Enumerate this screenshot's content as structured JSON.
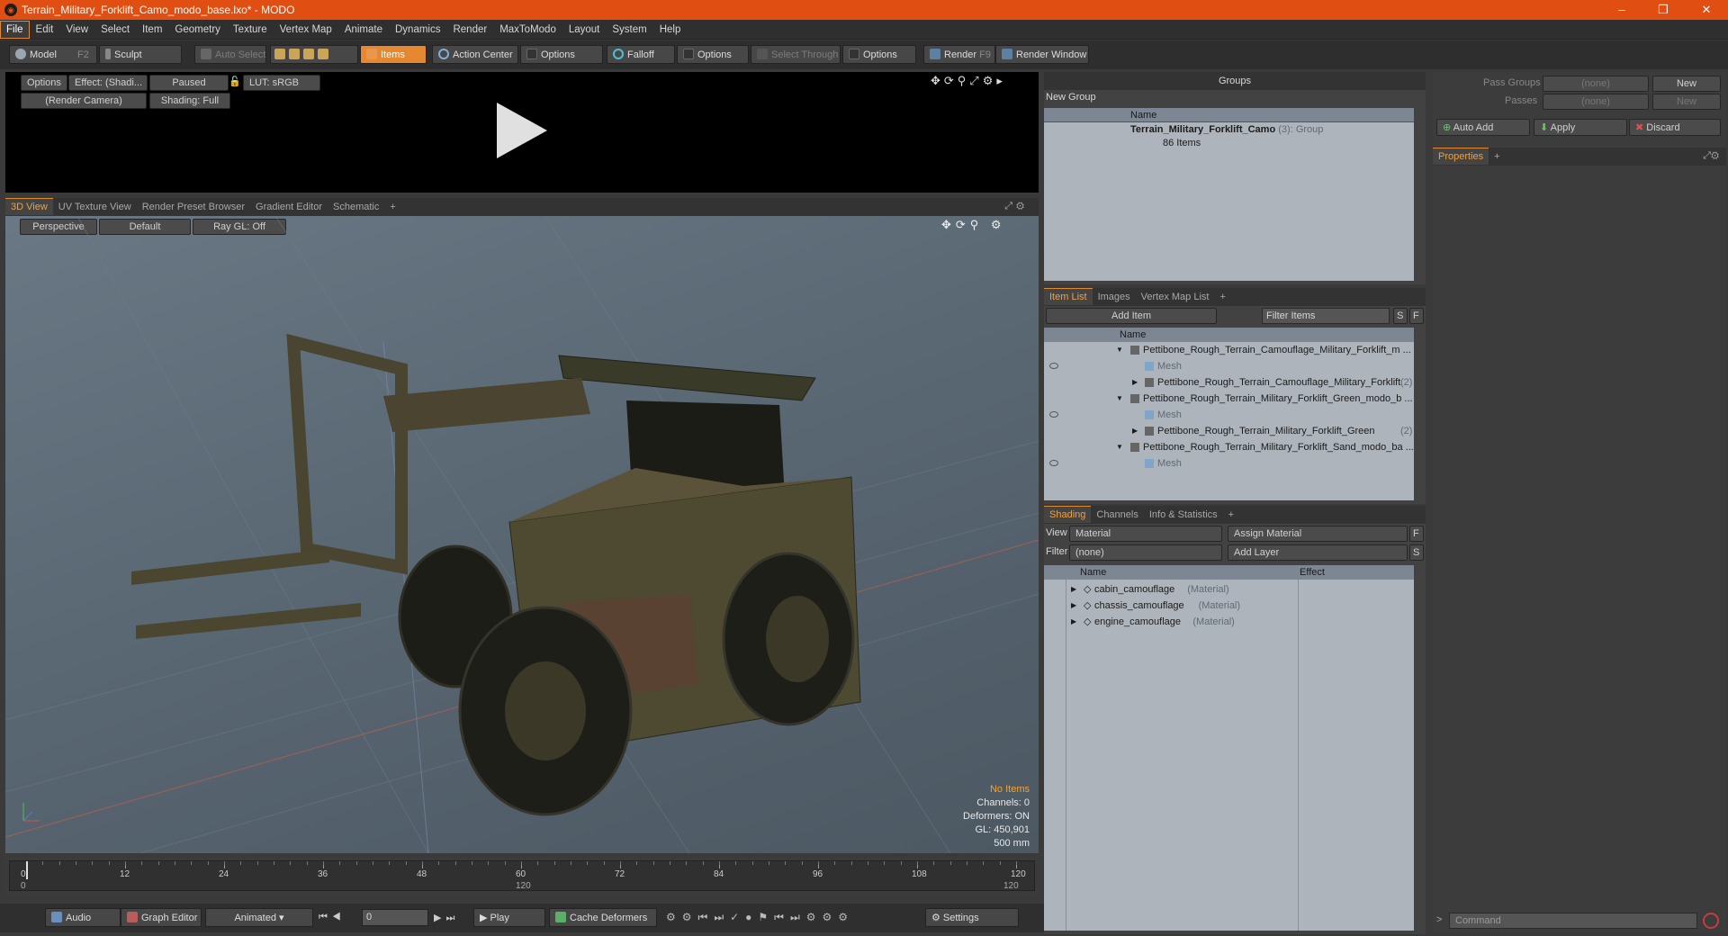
{
  "window": {
    "title": "Terrain_Military_Forklift_Camo_modo_base.lxo* - MODO",
    "app_icon": "modo-logo",
    "minimize": "–",
    "restore": "❐",
    "close": "✕"
  },
  "menu": [
    "File",
    "Edit",
    "View",
    "Select",
    "Item",
    "Geometry",
    "Texture",
    "Vertex Map",
    "Animate",
    "Dynamics",
    "Render",
    "MaxToModo",
    "Layout",
    "System",
    "Help"
  ],
  "toolbar": {
    "model": "Model",
    "model_key": "F2",
    "sculpt": "Sculpt",
    "auto_select": "Auto Select",
    "items": "Items",
    "action_center": "Action Center",
    "options1": "Options",
    "falloff": "Falloff",
    "options2": "Options",
    "select_through": "Select Through",
    "options3": "Options",
    "render": "Render",
    "render_key": "F9",
    "render_window": "Render Window"
  },
  "preview": {
    "options": "Options",
    "effect": "Effect: (Shadi...",
    "paused": "Paused",
    "lut": "LUT: sRGB",
    "camera": "(Render Camera)",
    "shading": "Shading: Full"
  },
  "viewport_tabs": [
    "3D View",
    "UV Texture View",
    "Render Preset Browser",
    "Gradient Editor",
    "Schematic",
    "+"
  ],
  "viewport": {
    "perspective": "Perspective",
    "default": "Default",
    "raygl": "Ray GL: Off",
    "info": {
      "no_items": "No Items",
      "channels": "Channels: 0",
      "deformers": "Deformers: ON",
      "gl": "GL: 450,901",
      "scale": "500 mm"
    }
  },
  "timeline": {
    "ticks_top": [
      "0",
      "12",
      "24",
      "36",
      "48",
      "60",
      "72",
      "84",
      "96",
      "108",
      "120"
    ],
    "ticks_bottom": [
      "0",
      "120",
      "120"
    ]
  },
  "bottom_bar": {
    "audio": "Audio",
    "graph_editor": "Graph Editor",
    "animated": "Animated",
    "frame": "0",
    "play": "Play",
    "cache_deformers": "Cache Deformers",
    "settings": "Settings"
  },
  "groups": {
    "title": "Groups",
    "new_group": "New Group",
    "col_name": "Name",
    "item_name": "Terrain_Military_Forklift_Camo",
    "item_count": "(3)",
    "item_type": ": Group",
    "item_sub": "86 Items"
  },
  "item_list": {
    "tabs": [
      "Item List",
      "Images",
      "Vertex Map List",
      "+"
    ],
    "add_item": "Add Item",
    "filter": "Filter Items",
    "s": "S",
    "f": "F",
    "col_name": "Name",
    "rows": [
      {
        "text": "Pettibone_Rough_Terrain_Camouflage_Military_Forklift_m ...",
        "suffix": "",
        "indent": 0,
        "mesh": false,
        "arrow": "▼"
      },
      {
        "text": "Mesh",
        "suffix": "",
        "indent": 1,
        "mesh": true,
        "arrow": ""
      },
      {
        "text": "Pettibone_Rough_Terrain_Camouflage_Military_Forklift",
        "suffix": "(2)",
        "indent": 1,
        "mesh": false,
        "arrow": "▶"
      },
      {
        "text": "Pettibone_Rough_Terrain_Military_Forklift_Green_modo_b ...",
        "suffix": "",
        "indent": 0,
        "mesh": false,
        "arrow": "▼"
      },
      {
        "text": "Mesh",
        "suffix": "",
        "indent": 1,
        "mesh": true,
        "arrow": ""
      },
      {
        "text": "Pettibone_Rough_Terrain_Military_Forklift_Green",
        "suffix": "(2)",
        "indent": 1,
        "mesh": false,
        "arrow": "▶"
      },
      {
        "text": "Pettibone_Rough_Terrain_Military_Forklift_Sand_modo_ba ...",
        "suffix": "",
        "indent": 0,
        "mesh": false,
        "arrow": "▼"
      },
      {
        "text": "Mesh",
        "suffix": "",
        "indent": 1,
        "mesh": true,
        "arrow": ""
      }
    ]
  },
  "shading": {
    "tabs": [
      "Shading",
      "Channels",
      "Info & Statistics",
      "+"
    ],
    "view_label": "View",
    "view_value": "Material",
    "assign": "Assign Material",
    "f": "F",
    "filter_label": "Filter",
    "filter_value": "(none)",
    "add_layer": "Add Layer",
    "s": "S",
    "col_name": "Name",
    "col_effect": "Effect",
    "rows": [
      {
        "name": "cabin_camouflage",
        "type": "(Material)"
      },
      {
        "name": "chassis_camouflage",
        "type": "(Material)"
      },
      {
        "name": "engine_camouflage",
        "type": "(Material)"
      }
    ]
  },
  "right": {
    "pass_groups": "Pass Groups",
    "pass_value": "(none)",
    "new": "New",
    "passes": "Passes",
    "passes_value": "(none)",
    "new2": "New",
    "auto_add": "Auto Add",
    "apply": "Apply",
    "discard": "Discard",
    "properties": "Properties",
    "plus": "+",
    "command": "Command",
    "prompt": ">"
  }
}
